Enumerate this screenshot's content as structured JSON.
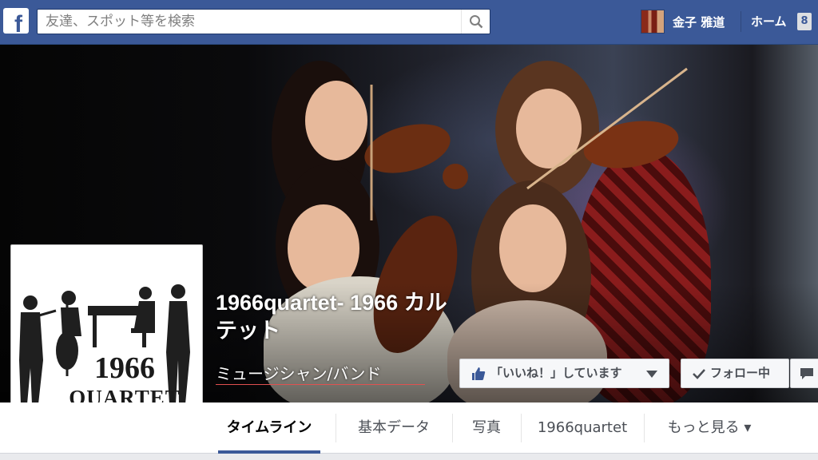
{
  "brand": {
    "logo_glyph": "f",
    "color": "#3b5998"
  },
  "search": {
    "placeholder": "友達、スポット等を検索",
    "icon": "search-icon"
  },
  "user": {
    "name": "金子 雅道",
    "avatar": "user-avatar"
  },
  "nav": {
    "home_label": "ホーム",
    "notification_count": "8"
  },
  "page": {
    "title": "1966quartet- 1966 カルテット",
    "category": "ミュージシャン/バンド",
    "profile_logo_line1": "1966",
    "profile_logo_line2": "QUARTET"
  },
  "actions": {
    "like_label": "「いいね！」しています",
    "follow_label": "フォロー中",
    "message_icon": "message-icon"
  },
  "tabs": [
    {
      "label": "タイムライン",
      "active": true
    },
    {
      "label": "基本データ"
    },
    {
      "label": "写真"
    },
    {
      "label": "1966quartet"
    },
    {
      "label": "もっと見る ▾"
    }
  ]
}
